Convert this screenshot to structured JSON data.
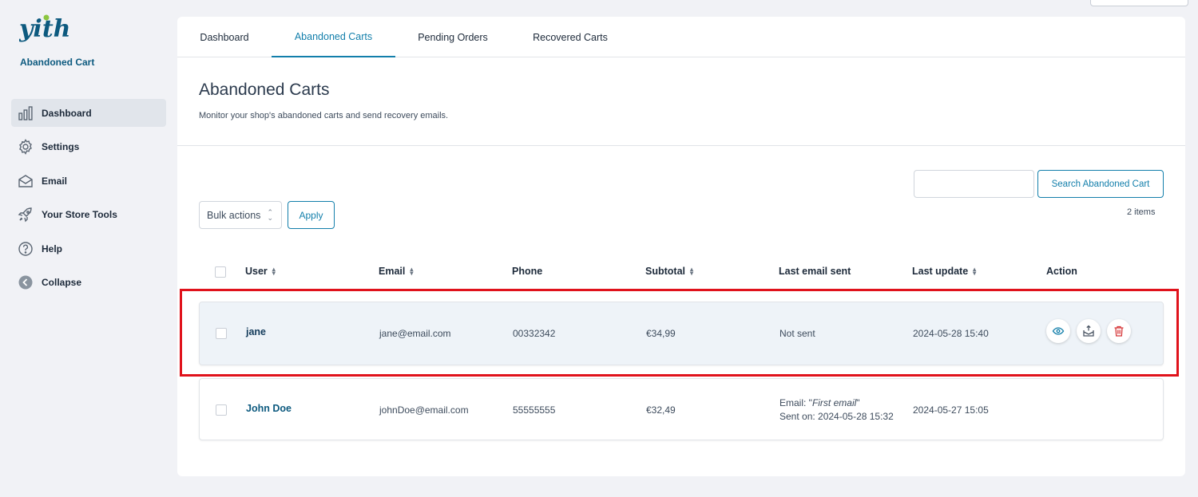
{
  "sidebar": {
    "logo_text": "yith",
    "plugin_name": "Abandoned Cart",
    "items": [
      {
        "label": "Dashboard",
        "icon": "bar-chart-icon",
        "active": true
      },
      {
        "label": "Settings",
        "icon": "gear-icon"
      },
      {
        "label": "Email",
        "icon": "envelope-icon"
      },
      {
        "label": "Your Store Tools",
        "icon": "rocket-icon"
      },
      {
        "label": "Help",
        "icon": "question-circle-icon"
      },
      {
        "label": "Collapse",
        "icon": "collapse-arrow-icon"
      }
    ]
  },
  "tabs": [
    {
      "label": "Dashboard"
    },
    {
      "label": "Abandoned Carts",
      "active": true
    },
    {
      "label": "Pending Orders"
    },
    {
      "label": "Recovered Carts"
    }
  ],
  "page": {
    "title": "Abandoned Carts",
    "description": "Monitor your shop's abandoned carts and send recovery emails."
  },
  "search": {
    "value": "",
    "button_label": "Search Abandoned Cart"
  },
  "items_count": "2 items",
  "bulk": {
    "selected": "Bulk actions",
    "apply_label": "Apply"
  },
  "table": {
    "headers": {
      "user": "User",
      "email": "Email",
      "phone": "Phone",
      "subtotal": "Subtotal",
      "last_email": "Last email sent",
      "last_update": "Last update",
      "action": "Action"
    },
    "rows": [
      {
        "user": "jane",
        "email": "jane@email.com",
        "phone": "00332342",
        "subtotal": "€34,99",
        "last_email": "Not sent",
        "last_update": "2024-05-28 15:40",
        "actions": [
          "eye-icon",
          "send-email-icon",
          "trash-icon"
        ]
      },
      {
        "user": "John Doe",
        "email": "johnDoe@email.com",
        "phone": "55555555",
        "subtotal": "€32,49",
        "last_email_prefix": "Email: \"",
        "last_email_name": "First email",
        "last_email_suffix": "\"",
        "last_email_sent_on": "Sent on: 2024-05-28 15:32",
        "last_update": "2024-05-27 15:05"
      }
    ]
  },
  "colors": {
    "accent": "#137fab",
    "brand_dark": "#0d5a7f",
    "logo_leaf": "#8cc63f",
    "highlight": "#e0121b",
    "danger": "#d63638"
  }
}
